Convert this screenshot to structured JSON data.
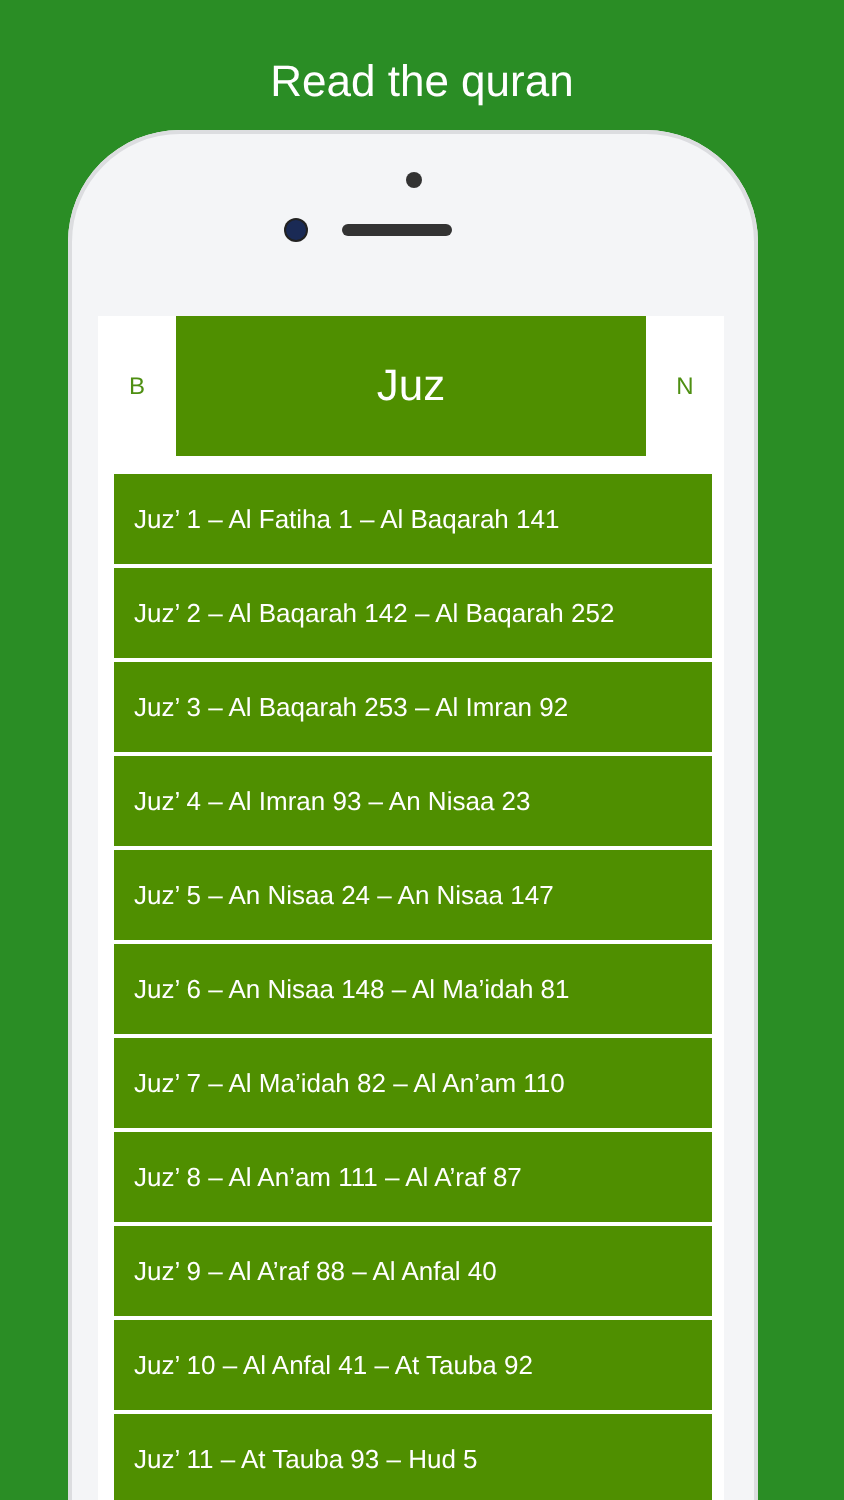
{
  "caption": "Read the quran",
  "header": {
    "back": "B",
    "title": "Juz",
    "next": "N"
  },
  "juz_list": [
    {
      "label": "Juz’ 1 – Al Fatiha 1 – Al Baqarah 141"
    },
    {
      "label": "Juz’ 2 – Al Baqarah 142 – Al Baqarah 252"
    },
    {
      "label": "Juz’ 3 – Al Baqarah 253 – Al Imran 92"
    },
    {
      "label": "Juz’ 4 – Al Imran 93 – An Nisaa 23"
    },
    {
      "label": "Juz’ 5 – An Nisaa 24 – An Nisaa 147"
    },
    {
      "label": "Juz’ 6 – An Nisaa 148 – Al Ma’idah 81"
    },
    {
      "label": "Juz’ 7 – Al Ma’idah 82 – Al An’am 110"
    },
    {
      "label": "Juz’ 8 – Al An’am 111 – Al A’raf 87"
    },
    {
      "label": "Juz’ 9 – Al A’raf 88 – Al Anfal 40"
    },
    {
      "label": "Juz’ 10 – Al Anfal 41 – At Tauba 92"
    },
    {
      "label": "Juz’ 11 – At Tauba 93 – Hud 5"
    }
  ]
}
